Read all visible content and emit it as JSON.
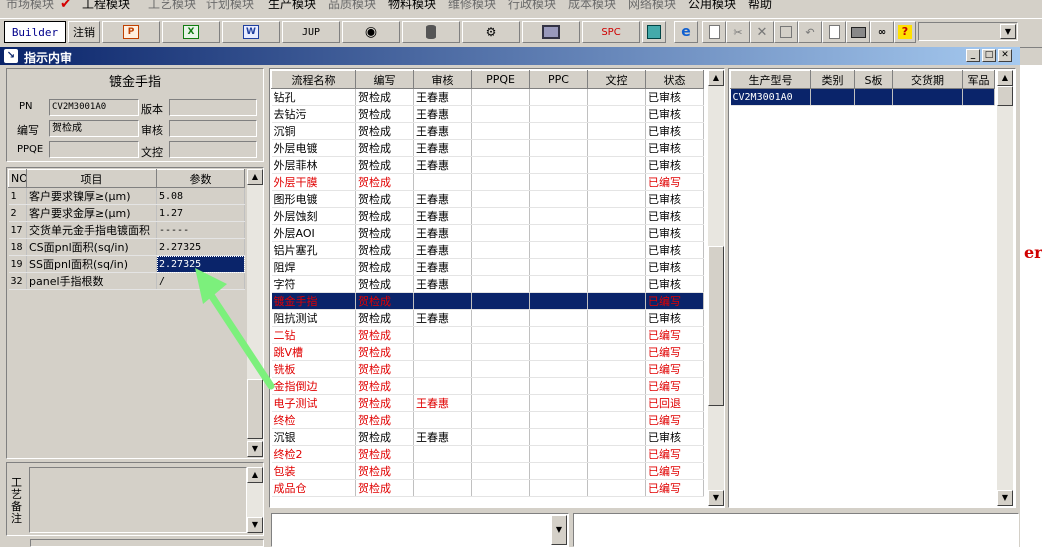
{
  "menu": [
    "市场模块",
    "工程模块",
    "工艺模块",
    "计划模块",
    "生产模块",
    "品质模块",
    "物料模块",
    "维修模块",
    "行政模块",
    "成本模块",
    "网络模块",
    "公用模块",
    "帮助"
  ],
  "toolbar": {
    "builder": "Builder",
    "logout": "注销",
    "jup": "JUP",
    "spc": "SPC"
  },
  "window": {
    "title": "指示内审"
  },
  "left": {
    "header": "镀金手指",
    "labels": {
      "pn": "PN",
      "version": "版本",
      "author": "编写",
      "review": "审核",
      "ppqe": "PPQE",
      "doccontrol": "文控"
    },
    "values": {
      "pn": "CV2M3001A0",
      "version": "",
      "author": "贺检成",
      "review": "",
      "ppqe": "",
      "doccontrol": ""
    },
    "param_headers": [
      "NO",
      "项目",
      "参数"
    ],
    "params": [
      {
        "no": "1",
        "item": "客户要求镍厚≥(μm)",
        "value": "5.08"
      },
      {
        "no": "2",
        "item": "客户要求金厚≥(μm)",
        "value": "1.27"
      },
      {
        "no": "17",
        "item": "交货单元金手指电镀面积",
        "value": "-----"
      },
      {
        "no": "18",
        "item": "CS面pnl面积(sq/in)",
        "value": "2.27325"
      },
      {
        "no": "19",
        "item": "SS面pnl面积(sq/in)",
        "value": "2.27325"
      },
      {
        "no": "32",
        "item": "panel手指根数",
        "value": "/"
      }
    ],
    "notes_label": "工艺备注"
  },
  "flow": {
    "headers": [
      "流程名称",
      "编写",
      "审核",
      "PPQE",
      "PPC",
      "文控",
      "状态"
    ],
    "rows": [
      {
        "name": "钻孔",
        "author": "贺检成",
        "review": "王春惠",
        "status": "已审核",
        "red": false
      },
      {
        "name": "去钻污",
        "author": "贺检成",
        "review": "王春惠",
        "status": "已审核",
        "red": false
      },
      {
        "name": "沉铜",
        "author": "贺检成",
        "review": "王春惠",
        "status": "已审核",
        "red": false
      },
      {
        "name": "外层电镀",
        "author": "贺检成",
        "review": "王春惠",
        "status": "已审核",
        "red": false
      },
      {
        "name": "外层菲林",
        "author": "贺检成",
        "review": "王春惠",
        "status": "已审核",
        "red": false
      },
      {
        "name": "外层干膜",
        "author": "贺检成",
        "review": "",
        "status": "已编写",
        "red": true
      },
      {
        "name": "图形电镀",
        "author": "贺检成",
        "review": "王春惠",
        "status": "已审核",
        "red": false
      },
      {
        "name": "外层蚀刻",
        "author": "贺检成",
        "review": "王春惠",
        "status": "已审核",
        "red": false
      },
      {
        "name": "外层AOI",
        "author": "贺检成",
        "review": "王春惠",
        "status": "已审核",
        "red": false
      },
      {
        "name": "铝片塞孔",
        "author": "贺检成",
        "review": "王春惠",
        "status": "已审核",
        "red": false
      },
      {
        "name": "阻焊",
        "author": "贺检成",
        "review": "王春惠",
        "status": "已审核",
        "red": false
      },
      {
        "name": "字符",
        "author": "贺检成",
        "review": "王春惠",
        "status": "已审核",
        "red": false
      },
      {
        "name": "镀金手指",
        "author": "贺检成",
        "review": "",
        "status": "已编写",
        "red": true
      },
      {
        "name": "阻抗测试",
        "author": "贺检成",
        "review": "王春惠",
        "status": "已审核",
        "red": false
      },
      {
        "name": "二钻",
        "author": "贺检成",
        "review": "",
        "status": "已编写",
        "red": true
      },
      {
        "name": "跳V槽",
        "author": "贺检成",
        "review": "",
        "status": "已编写",
        "red": true
      },
      {
        "name": "铣板",
        "author": "贺检成",
        "review": "",
        "status": "已编写",
        "red": true
      },
      {
        "name": "金指倒边",
        "author": "贺检成",
        "review": "",
        "status": "已编写",
        "red": true
      },
      {
        "name": "电子测试",
        "author": "贺检成",
        "review": "王春惠",
        "status": "已回退",
        "red": true
      },
      {
        "name": "终检",
        "author": "贺检成",
        "review": "",
        "status": "已编写",
        "red": true
      },
      {
        "name": "沉银",
        "author": "贺检成",
        "review": "王春惠",
        "status": "已审核",
        "red": false
      },
      {
        "name": "终检2",
        "author": "贺检成",
        "review": "",
        "status": "已编写",
        "red": true
      },
      {
        "name": "包装",
        "author": "贺检成",
        "review": "",
        "status": "已编写",
        "red": true
      },
      {
        "name": "成品仓",
        "author": "贺检成",
        "review": "",
        "status": "已编写",
        "red": true
      }
    ]
  },
  "prod": {
    "headers": [
      "生产型号",
      "类别",
      "S板",
      "交货期",
      "军品"
    ],
    "rows": [
      {
        "model": "CV2M3001A0",
        "type": "",
        "s": "",
        "date": "",
        "mil": ""
      }
    ]
  },
  "edge_text": "er"
}
